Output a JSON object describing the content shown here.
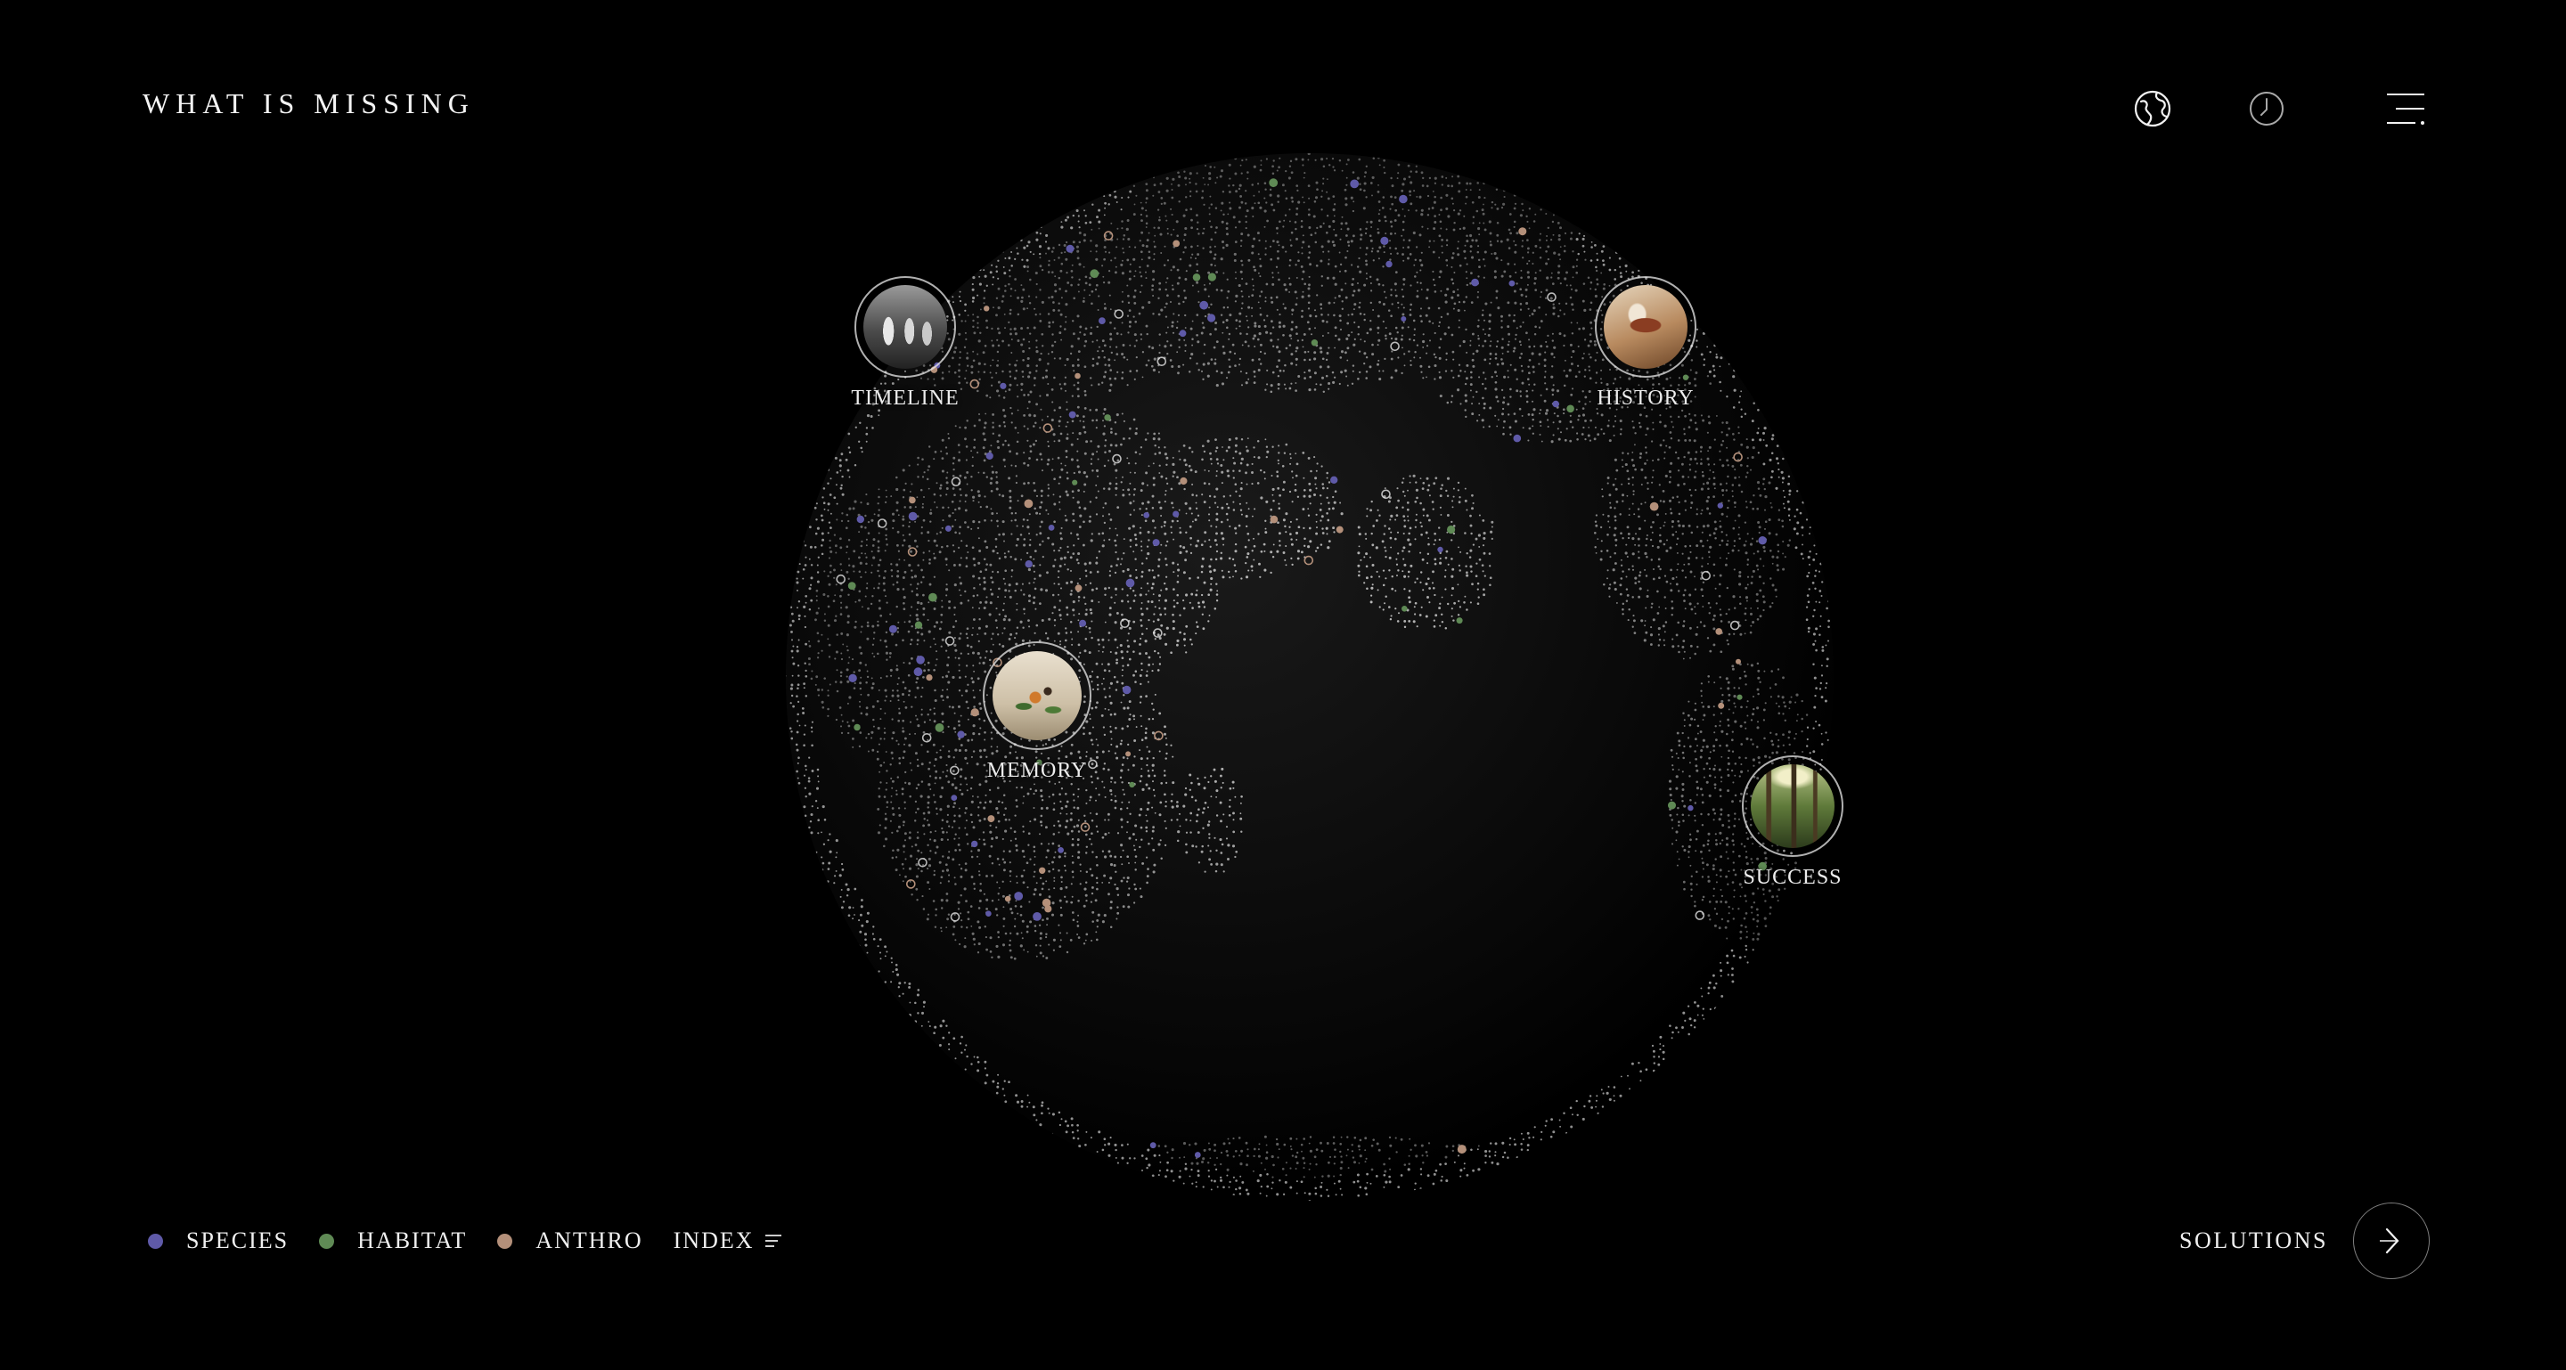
{
  "header": {
    "logo": "WHAT IS MISSING",
    "icons": [
      "globe-icon",
      "clock-icon",
      "menu-icon"
    ]
  },
  "globe": {
    "species_count": 48,
    "habitat_count": 22,
    "anthro_count": 26
  },
  "markers": [
    {
      "id": "timeline",
      "label": "TIMELINE",
      "image": "black-and-white-group-photo"
    },
    {
      "id": "history",
      "label": "HISTORY",
      "image": "cave-painting"
    },
    {
      "id": "memory",
      "label": "MEMORY",
      "image": "butterfly-on-flowers"
    },
    {
      "id": "success",
      "label": "SUCCESS",
      "image": "sunlit-forest"
    }
  ],
  "legend": {
    "species": {
      "label": "SPECIES",
      "color": "#5f5aa8"
    },
    "habitat": {
      "label": "HABITAT",
      "color": "#5f8a55"
    },
    "anthro": {
      "label": "ANTHRO",
      "color": "#b4907a"
    },
    "index": {
      "label": "INDEX",
      "icon": "list-icon"
    }
  },
  "footer": {
    "solutions_label": "SOLUTIONS",
    "solutions_icon": "arrow-right-icon"
  }
}
